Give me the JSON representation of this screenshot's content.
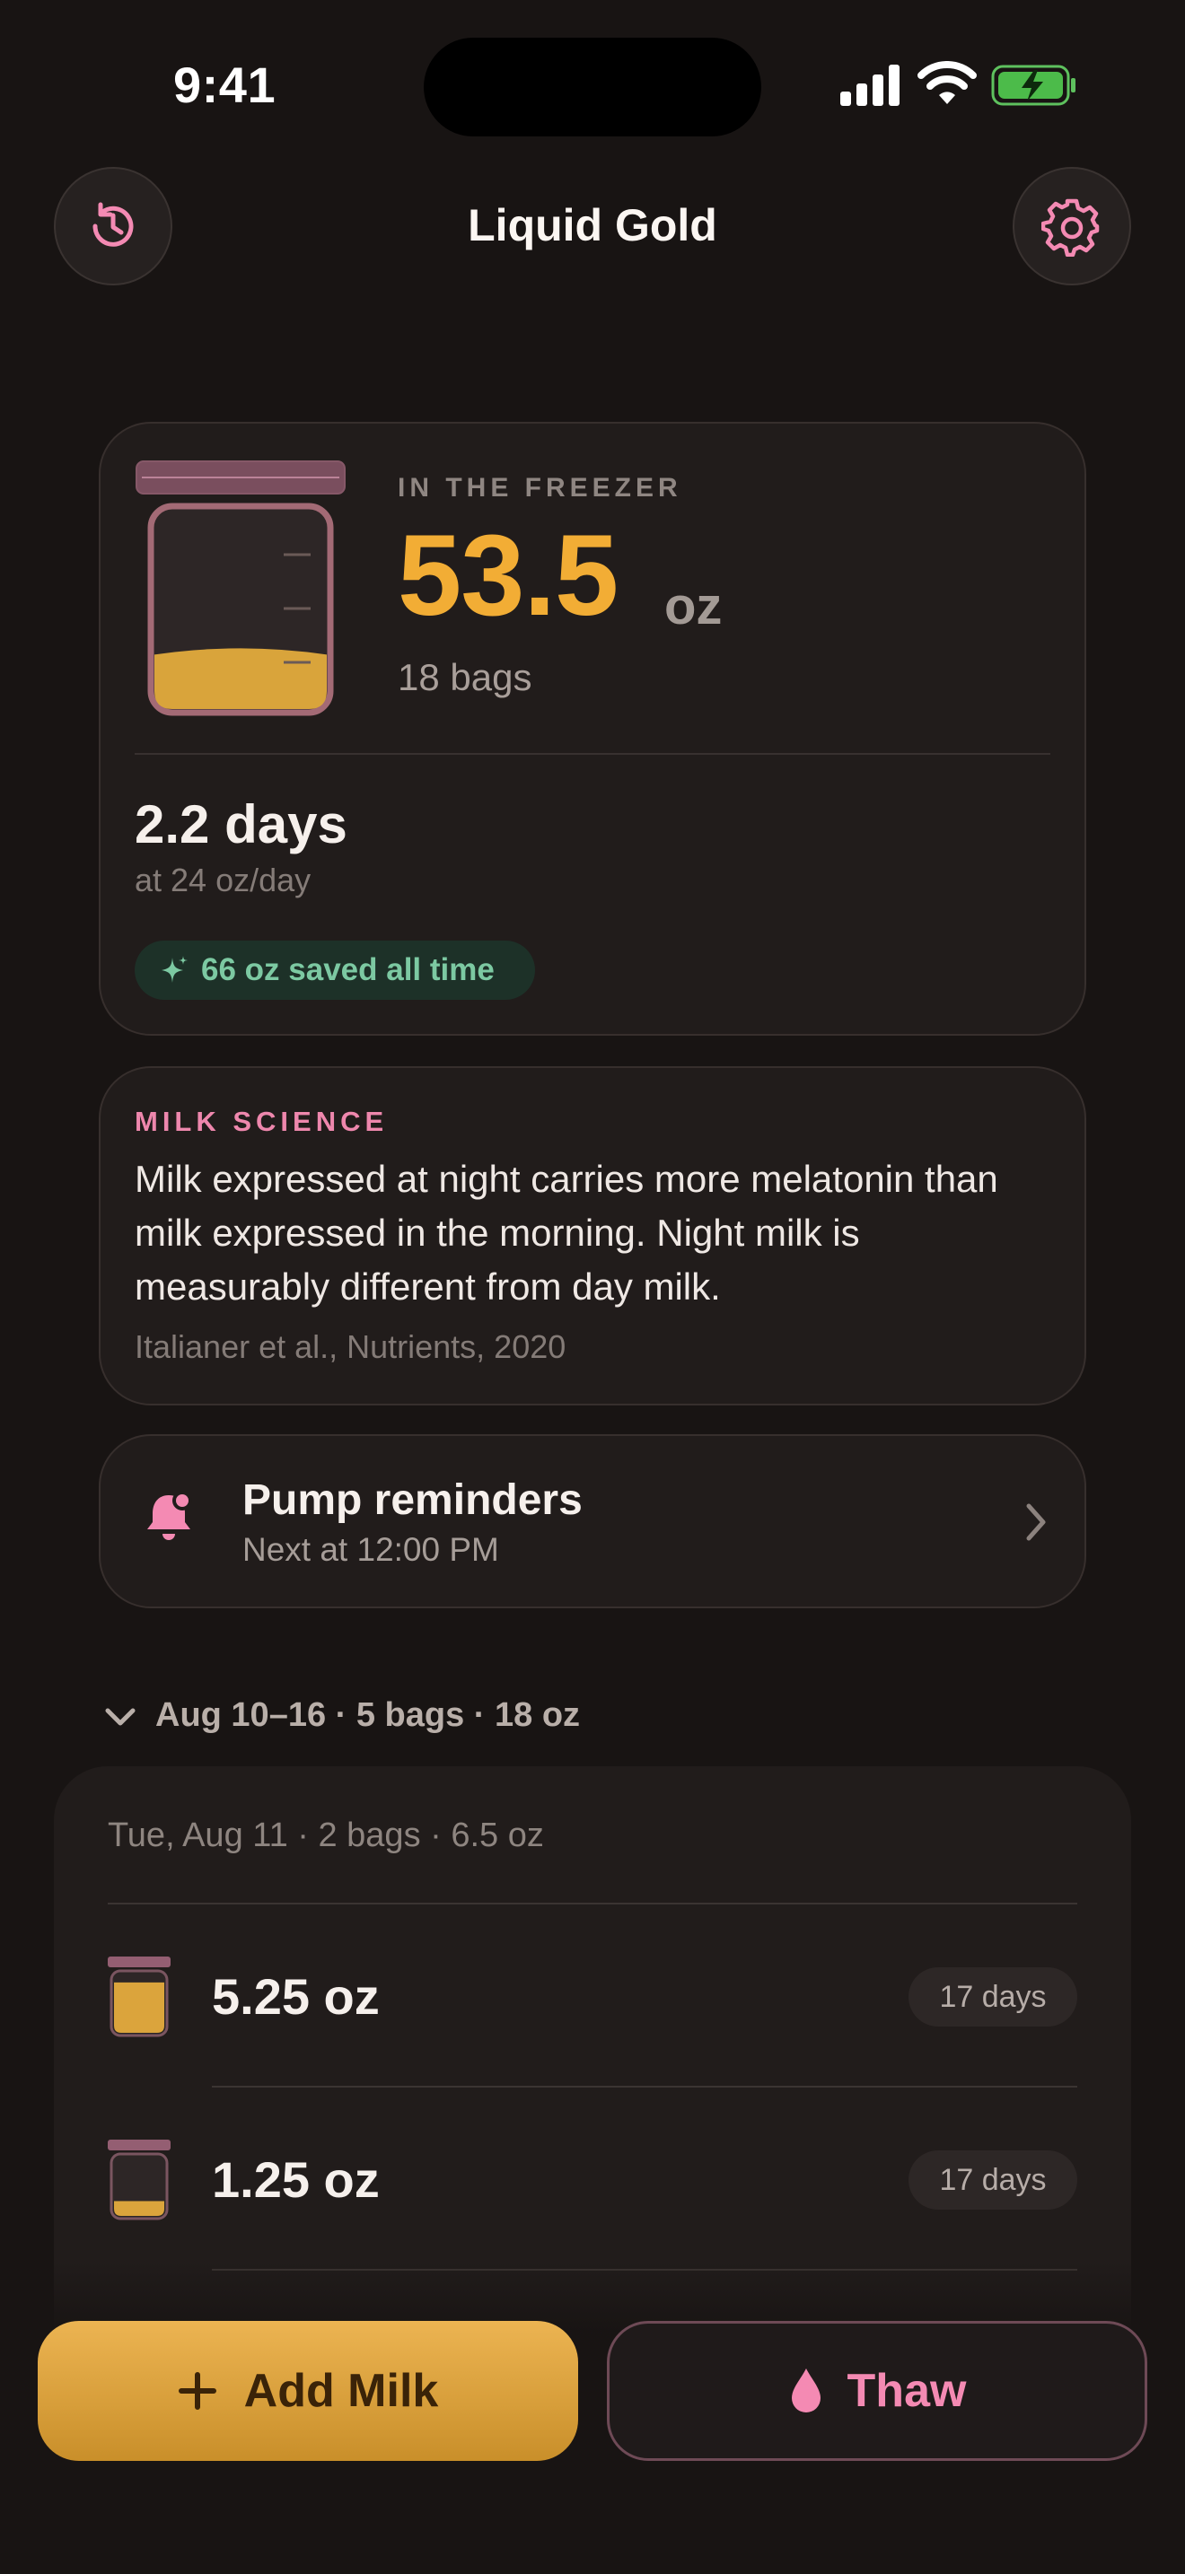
{
  "status_bar": {
    "time": "9:41"
  },
  "nav": {
    "title": "Liquid Gold",
    "history_icon": "history-clock-icon",
    "settings_icon": "gear-icon"
  },
  "freezer": {
    "label": "IN THE FREEZER",
    "amount": "53.5",
    "unit": "oz",
    "bags": "18 bags",
    "days": "2.2 days",
    "rate": "at 24 oz/day",
    "saved": "66 oz saved all time",
    "jar_fill_level": 0.3
  },
  "science": {
    "label": "MILK SCIENCE",
    "text": "Milk expressed at night carries more melatonin than milk expressed in the morning. Night milk is measurably different from day milk.",
    "citation": "Italianer et al., Nutrients, 2020"
  },
  "reminder": {
    "title": "Pump reminders",
    "subtitle": "Next at 12:00 PM"
  },
  "week": {
    "label": "Aug 10–16 · 5 bags · 18 oz"
  },
  "day_group": {
    "label": "Tue, Aug 11 · 2 bags · 6.5 oz",
    "items": [
      {
        "amount": "5.25 oz",
        "age": "17 days",
        "fill_level": 0.85
      },
      {
        "amount": "1.25 oz",
        "age": "17 days",
        "fill_level": 0.25
      }
    ]
  },
  "actions": {
    "add_label": "Add Milk",
    "thaw_label": "Thaw"
  },
  "colors": {
    "background": "#181413",
    "gold": "#f2ad35",
    "pink": "#f48ab3",
    "green": "#7cc9a2",
    "card": "#211c1b"
  }
}
